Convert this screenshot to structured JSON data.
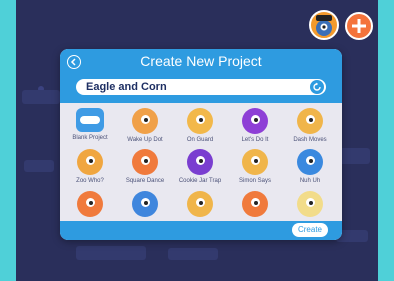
{
  "dialog": {
    "title": "Create New Project",
    "project_name": "Eagle and Corn",
    "create_label": "Create"
  },
  "projects": [
    {
      "label": "Blank Project",
      "icon": "blank-project-icon",
      "color": "#3f9be5"
    },
    {
      "label": "Wake Up Dot",
      "icon": "wake-up-dot-icon",
      "color": "#f0a048"
    },
    {
      "label": "On Guard",
      "icon": "on-guard-icon",
      "color": "#f2b84a"
    },
    {
      "label": "Let's Do It",
      "icon": "lets-do-it-icon",
      "color": "#8e3fd6"
    },
    {
      "label": "Dash Moves",
      "icon": "dash-moves-icon",
      "color": "#f0b54a"
    },
    {
      "label": "Zoo Who?",
      "icon": "zoo-who-icon",
      "color": "#f0a640"
    },
    {
      "label": "Square Dance",
      "icon": "square-dance-icon",
      "color": "#f07a3c"
    },
    {
      "label": "Cookie Jar Trap",
      "icon": "cookie-jar-trap-icon",
      "color": "#7a3ed0"
    },
    {
      "label": "Simon Says",
      "icon": "simon-says-icon",
      "color": "#f0b54a"
    },
    {
      "label": "Nuh Uh",
      "icon": "nuh-uh-icon",
      "color": "#3a89df"
    },
    {
      "label": "",
      "icon": "dot-robot-icon",
      "color": "#f07a3c"
    },
    {
      "label": "",
      "icon": "dash-robot-icon",
      "color": "#3f86dd"
    },
    {
      "label": "",
      "icon": "cowboy-robot-icon",
      "color": "#f0b54a"
    },
    {
      "label": "",
      "icon": "firefighter-robot-icon",
      "color": "#f07a3c"
    },
    {
      "label": "",
      "icon": "yellow-robot-icon",
      "color": "#f2dc8a"
    }
  ],
  "colors": {
    "accent": "#2e9be0",
    "frame": "#4fd0d8",
    "background": "#2a2f5b"
  }
}
